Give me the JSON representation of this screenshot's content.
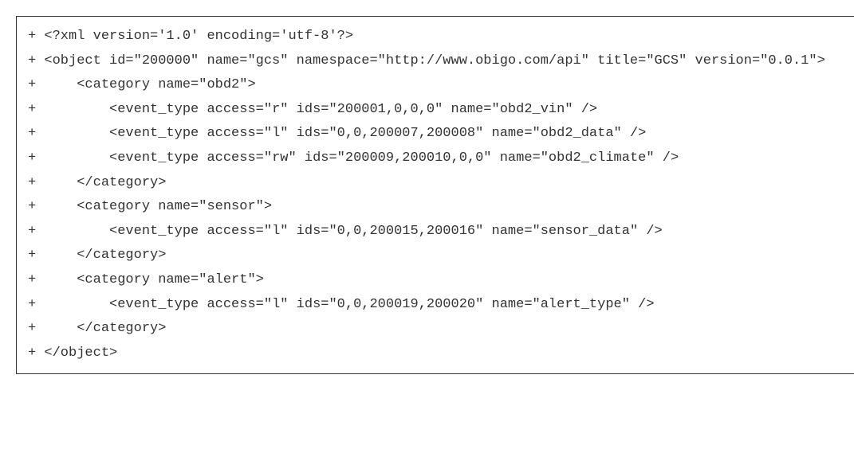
{
  "lines": [
    {
      "prefix": "+ ",
      "text": "<?xml version='1.0' encoding='utf-8'?>"
    },
    {
      "prefix": "+ ",
      "text": "<object id=\"200000\" name=\"gcs\" namespace=\"http://www.obigo.com/api\" title=\"GCS\" version=\"0.0.1\">"
    },
    {
      "prefix": "+     ",
      "text": "<category name=\"obd2\">"
    },
    {
      "prefix": "+         ",
      "text": "<event_type access=\"r\" ids=\"200001,0,0,0\" name=\"obd2_vin\" />"
    },
    {
      "prefix": "+         ",
      "text": "<event_type access=\"l\" ids=\"0,0,200007,200008\" name=\"obd2_data\" />"
    },
    {
      "prefix": "+         ",
      "text": "<event_type access=\"rw\" ids=\"200009,200010,0,0\" name=\"obd2_climate\" />"
    },
    {
      "prefix": "+     ",
      "text": "</category>"
    },
    {
      "prefix": "+     ",
      "text": "<category name=\"sensor\">"
    },
    {
      "prefix": "+         ",
      "text": "<event_type access=\"l\" ids=\"0,0,200015,200016\" name=\"sensor_data\" />"
    },
    {
      "prefix": "+     ",
      "text": "</category>"
    },
    {
      "prefix": "+     ",
      "text": "<category name=\"alert\">"
    },
    {
      "prefix": "+         ",
      "text": "<event_type access=\"l\" ids=\"0,0,200019,200020\" name=\"alert_type\" />"
    },
    {
      "prefix": "+     ",
      "text": "</category>"
    },
    {
      "prefix": "+ ",
      "text": "</object>"
    }
  ]
}
